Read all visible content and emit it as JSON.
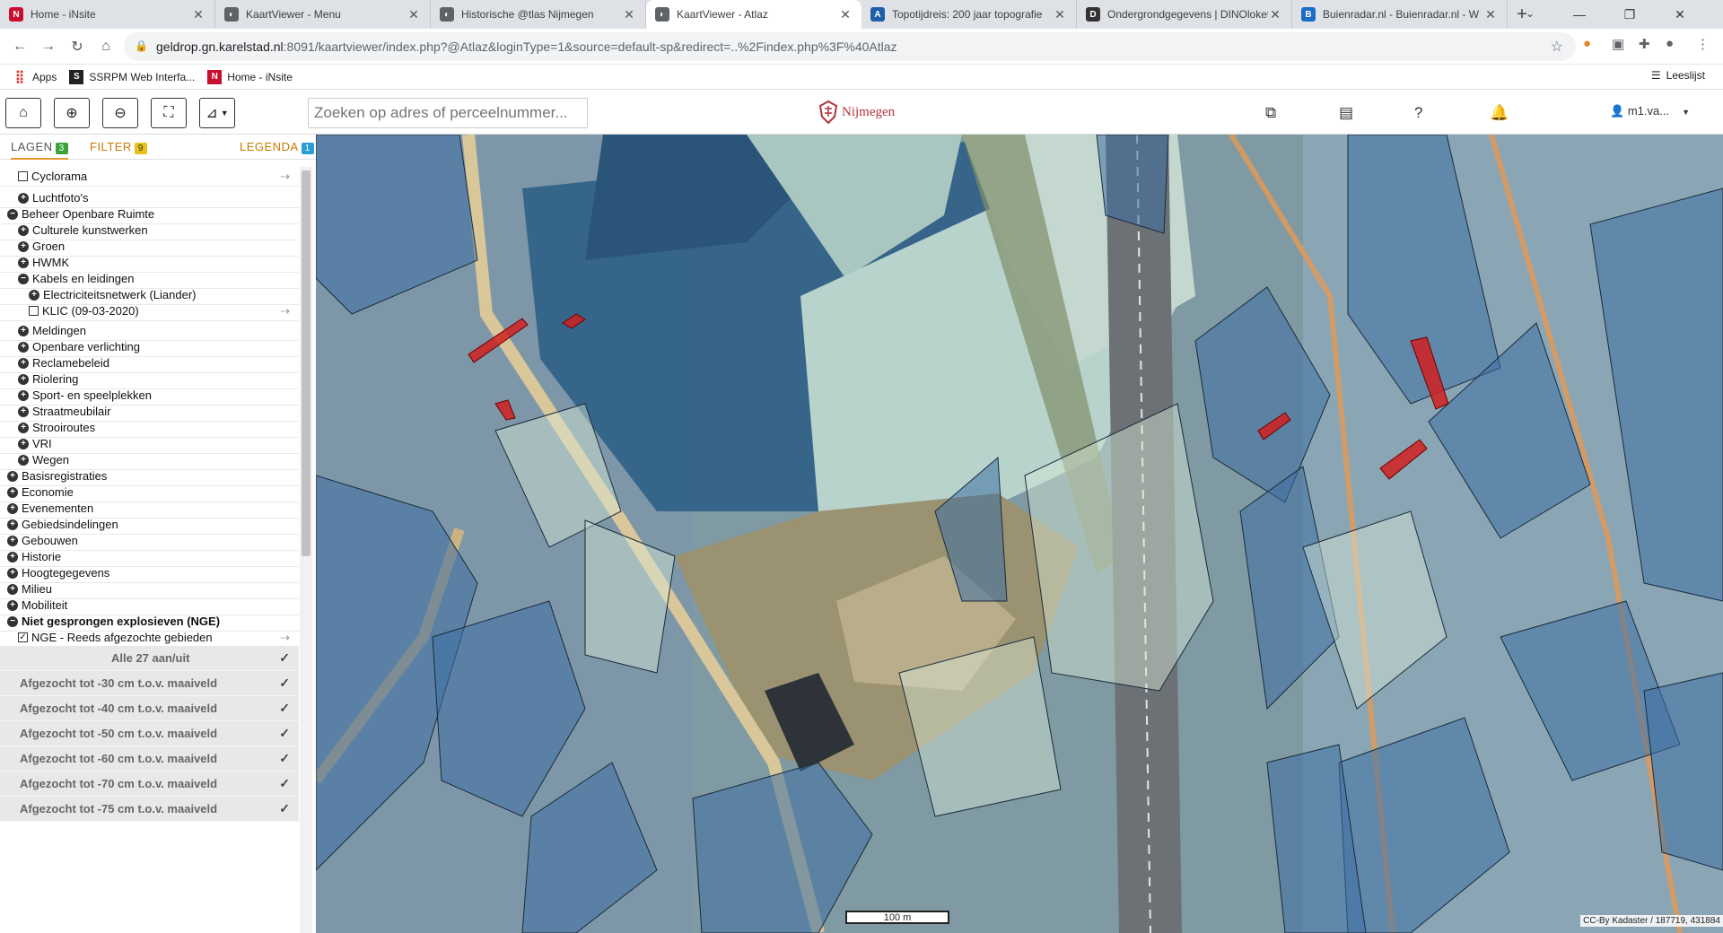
{
  "browser": {
    "tabs": [
      {
        "title": "Home - iNsite",
        "icon": "n-icon",
        "active": false
      },
      {
        "title": "KaartViewer - Menu",
        "icon": "globe-icon",
        "active": false
      },
      {
        "title": "Historische @tlas Nijmegen",
        "icon": "globe-icon",
        "active": false
      },
      {
        "title": "KaartViewer - Atlaz",
        "icon": "globe-icon",
        "active": true
      },
      {
        "title": "Topotijdreis: 200 jaar topografie",
        "icon": "topo-icon",
        "active": false
      },
      {
        "title": "Ondergrondgegevens | DINOloket",
        "icon": "dino-icon",
        "active": false
      },
      {
        "title": "Buienradar.nl - Buienradar.nl - W",
        "icon": "buienradar-icon",
        "active": false
      }
    ],
    "url_host": "geldrop.gn.karelstad.nl",
    "url_path": ":8091/kaartviewer/index.php?@Atlaz&loginType=1&source=default-sp&redirect=..%2Findex.php%3F%40Atlaz",
    "bookmarks": [
      "Apps",
      "SSRPM Web Interfa...",
      "Home - iNsite"
    ],
    "reading_list": "Leeslijst"
  },
  "app": {
    "search_placeholder": "Zoeken op adres of perceelnummer...",
    "logo_text": "Nijmegen",
    "user": "m1.va...",
    "panel_tabs": [
      {
        "label": "LAGEN",
        "badge": "3",
        "badge_color": "#3aa33a"
      },
      {
        "label": "FILTER",
        "badge": "9",
        "badge_color": "#e6c21a"
      },
      {
        "label": "LEGENDA",
        "badge": "1",
        "badge_color": "#2a9fd6"
      }
    ],
    "layers": [
      {
        "label": "Cyclorama",
        "indent": 1,
        "type": "checkbox",
        "info": true
      },
      {
        "label": "Luchtfoto's",
        "indent": 1,
        "type": "plus"
      },
      {
        "label": "Beheer Openbare Ruimte",
        "indent": 0,
        "type": "minus"
      },
      {
        "label": "Culturele kunstwerken",
        "indent": 1,
        "type": "plus"
      },
      {
        "label": "Groen",
        "indent": 1,
        "type": "plus"
      },
      {
        "label": "HWMK",
        "indent": 1,
        "type": "plus"
      },
      {
        "label": "Kabels en leidingen",
        "indent": 1,
        "type": "minus"
      },
      {
        "label": "Electriciteitsnetwerk (Liander)",
        "indent": 2,
        "type": "plus"
      },
      {
        "label": "KLIC (09-03-2020)",
        "indent": 2,
        "type": "checkbox",
        "info": true
      },
      {
        "label": "Meldingen",
        "indent": 1,
        "type": "plus"
      },
      {
        "label": "Openbare verlichting",
        "indent": 1,
        "type": "plus"
      },
      {
        "label": "Reclamebeleid",
        "indent": 1,
        "type": "plus"
      },
      {
        "label": "Riolering",
        "indent": 1,
        "type": "plus"
      },
      {
        "label": "Sport- en speelplekken",
        "indent": 1,
        "type": "plus"
      },
      {
        "label": "Straatmeubilair",
        "indent": 1,
        "type": "plus"
      },
      {
        "label": "Strooiroutes",
        "indent": 1,
        "type": "plus"
      },
      {
        "label": "VRI",
        "indent": 1,
        "type": "plus"
      },
      {
        "label": "Wegen",
        "indent": 1,
        "type": "plus"
      },
      {
        "label": "Basisregistraties",
        "indent": 0,
        "type": "plus"
      },
      {
        "label": "Economie",
        "indent": 0,
        "type": "plus"
      },
      {
        "label": "Evenementen",
        "indent": 0,
        "type": "plus"
      },
      {
        "label": "Gebiedsindelingen",
        "indent": 0,
        "type": "plus"
      },
      {
        "label": "Gebouwen",
        "indent": 0,
        "type": "plus"
      },
      {
        "label": "Historie",
        "indent": 0,
        "type": "plus"
      },
      {
        "label": "Hoogtegegevens",
        "indent": 0,
        "type": "plus"
      },
      {
        "label": "Milieu",
        "indent": 0,
        "type": "plus"
      },
      {
        "label": "Mobiliteit",
        "indent": 0,
        "type": "plus"
      },
      {
        "label": "Niet gesprongen explosieven (NGE)",
        "indent": 0,
        "type": "minus",
        "bold": true
      },
      {
        "label": "NGE - Reeds afgezochte gebieden",
        "indent": 1,
        "type": "checked",
        "info": true
      }
    ],
    "sublayers": [
      "Alle 27 aan/uit",
      "Afgezocht tot -30 cm t.o.v. maaiveld",
      "Afgezocht tot -40 cm t.o.v. maaiveld",
      "Afgezocht tot -50 cm t.o.v. maaiveld",
      "Afgezocht tot -60 cm t.o.v. maaiveld",
      "Afgezocht tot -70 cm t.o.v. maaiveld",
      "Afgezocht tot -75 cm t.o.v. maaiveld"
    ],
    "scale": "100 m",
    "attribution": "CC-By Kadaster / 187719, 431884"
  }
}
